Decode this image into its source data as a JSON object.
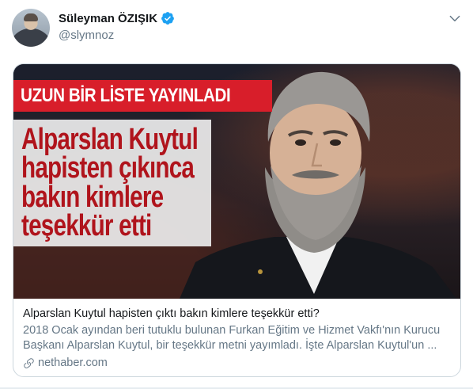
{
  "tweet": {
    "author": {
      "display_name": "Süleyman ÖZIŞIK",
      "handle": "@slymnoz",
      "verified": true
    },
    "menu_icon": "chevron-down-icon"
  },
  "card": {
    "image": {
      "banner_text": "UZUN BİR LİSTE YAYINLADI",
      "headline_lines": [
        "Alparslan Kuytul",
        "hapisten çıkınca",
        "bakın kimlere",
        "teşekkür etti"
      ]
    },
    "title": "Alparslan Kuytul hapisten çıktı bakın kimlere teşekkür etti?",
    "description": "2018 Ocak ayından beri tutuklu bulunan Furkan Eğitim ve Hizmet Vakfı'nın Kurucu Başkanı Alparslan Kuytul, bir teşekkür metni yayımladı. İşte Alparslan Kuytul'un ...",
    "domain": "nethaber.com",
    "link_icon": "link-icon"
  },
  "colors": {
    "verified_blue": "#1da1f2",
    "banner_red": "#d81e2a",
    "headline_red": "#b0141c",
    "secondary_text": "#657786",
    "card_border": "#ccd6dd"
  }
}
